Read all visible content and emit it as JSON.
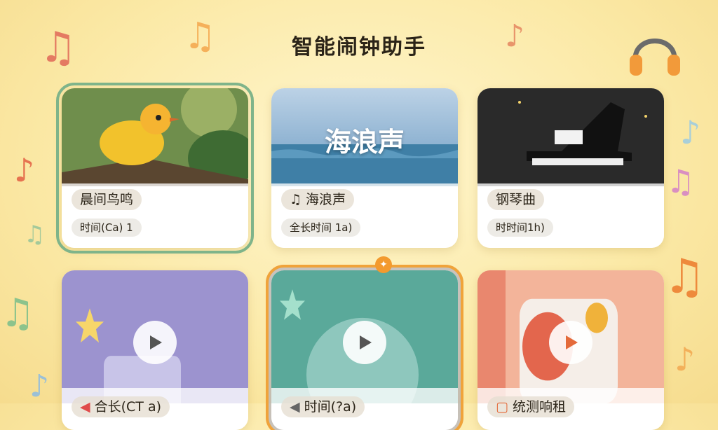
{
  "header": {
    "title": "智能闹钟助手"
  },
  "decor": {
    "note_glyph": "♫",
    "note_glyph2": "♪"
  },
  "cards": [
    {
      "title": "晨间鸟鸣",
      "subtitle": "时间(Ca) 1",
      "icon": ""
    },
    {
      "title": "海浪声",
      "subtitle": "全长时间 1a)",
      "icon": "speaker-icon",
      "overlay_text": "海浪声"
    },
    {
      "title": "钢琴曲",
      "subtitle": "时时间1h)",
      "icon": ""
    },
    {
      "title": "合长(CT a)",
      "icon": "speaker-icon"
    },
    {
      "title": "时间(?a)",
      "icon": "speaker-icon"
    },
    {
      "title": "统测响租",
      "icon": "square-icon"
    }
  ],
  "colors": {
    "accent_green": "#7fb48a",
    "accent_orange": "#f0a33a"
  }
}
